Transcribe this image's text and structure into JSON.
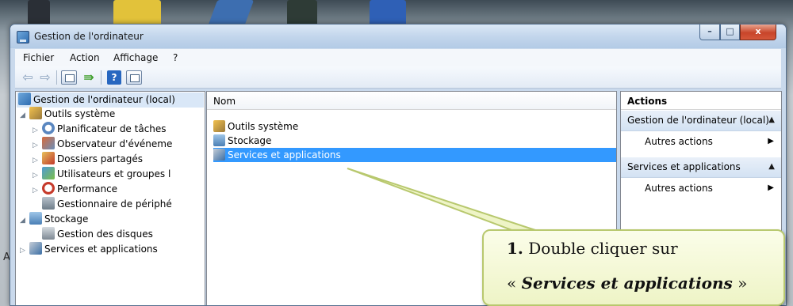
{
  "window": {
    "title": "Gestion de l'ordinateur",
    "controls": {
      "minimize": "–",
      "maximize": "□",
      "close": "x"
    }
  },
  "menubar": [
    "Fichier",
    "Action",
    "Affichage",
    "?"
  ],
  "toolbar": {
    "buttons": [
      "back-arrow-icon",
      "forward-arrow-icon",
      "console-tree-icon",
      "export-icon",
      "help-icon",
      "panel-icon"
    ],
    "help_glyph": "?"
  },
  "tree": {
    "root": "Gestion de l'ordinateur (local)",
    "items": [
      {
        "label": "Outils système",
        "level": 1,
        "expander": "◢"
      },
      {
        "label": "Planificateur de tâches",
        "level": 2,
        "expander": "▷"
      },
      {
        "label": "Observateur d'événeme",
        "level": 2,
        "expander": "▷"
      },
      {
        "label": "Dossiers partagés",
        "level": 2,
        "expander": "▷"
      },
      {
        "label": "Utilisateurs et groupes l",
        "level": 2,
        "expander": "▷"
      },
      {
        "label": "Performance",
        "level": 2,
        "expander": "▷"
      },
      {
        "label": "Gestionnaire de périphé",
        "level": 2,
        "expander": ""
      },
      {
        "label": "Stockage",
        "level": 1,
        "expander": "◢"
      },
      {
        "label": "Gestion des disques",
        "level": 2,
        "expander": ""
      },
      {
        "label": "Services et applications",
        "level": 1,
        "expander": "▷"
      }
    ]
  },
  "list": {
    "column": "Nom",
    "rows": [
      "Outils système",
      "Stockage",
      "Services et applications"
    ],
    "selected_index": 2
  },
  "actions": {
    "header": "Actions",
    "section1": "Gestion de l'ordinateur (local)",
    "section1_item": "Autres actions",
    "section2": "Services et applications",
    "section2_item": "Autres actions"
  },
  "desktop": {
    "edge_letter": "A"
  },
  "callout": {
    "number": "1.",
    "line1": "Double cliquer sur",
    "quote_open": "« ",
    "emphasis": "Services et applications",
    "quote_close": " »"
  },
  "colors": {
    "selection": "#3399ff",
    "callout_border": "#b8c86e",
    "callout_fill": "#f3f7d4"
  }
}
